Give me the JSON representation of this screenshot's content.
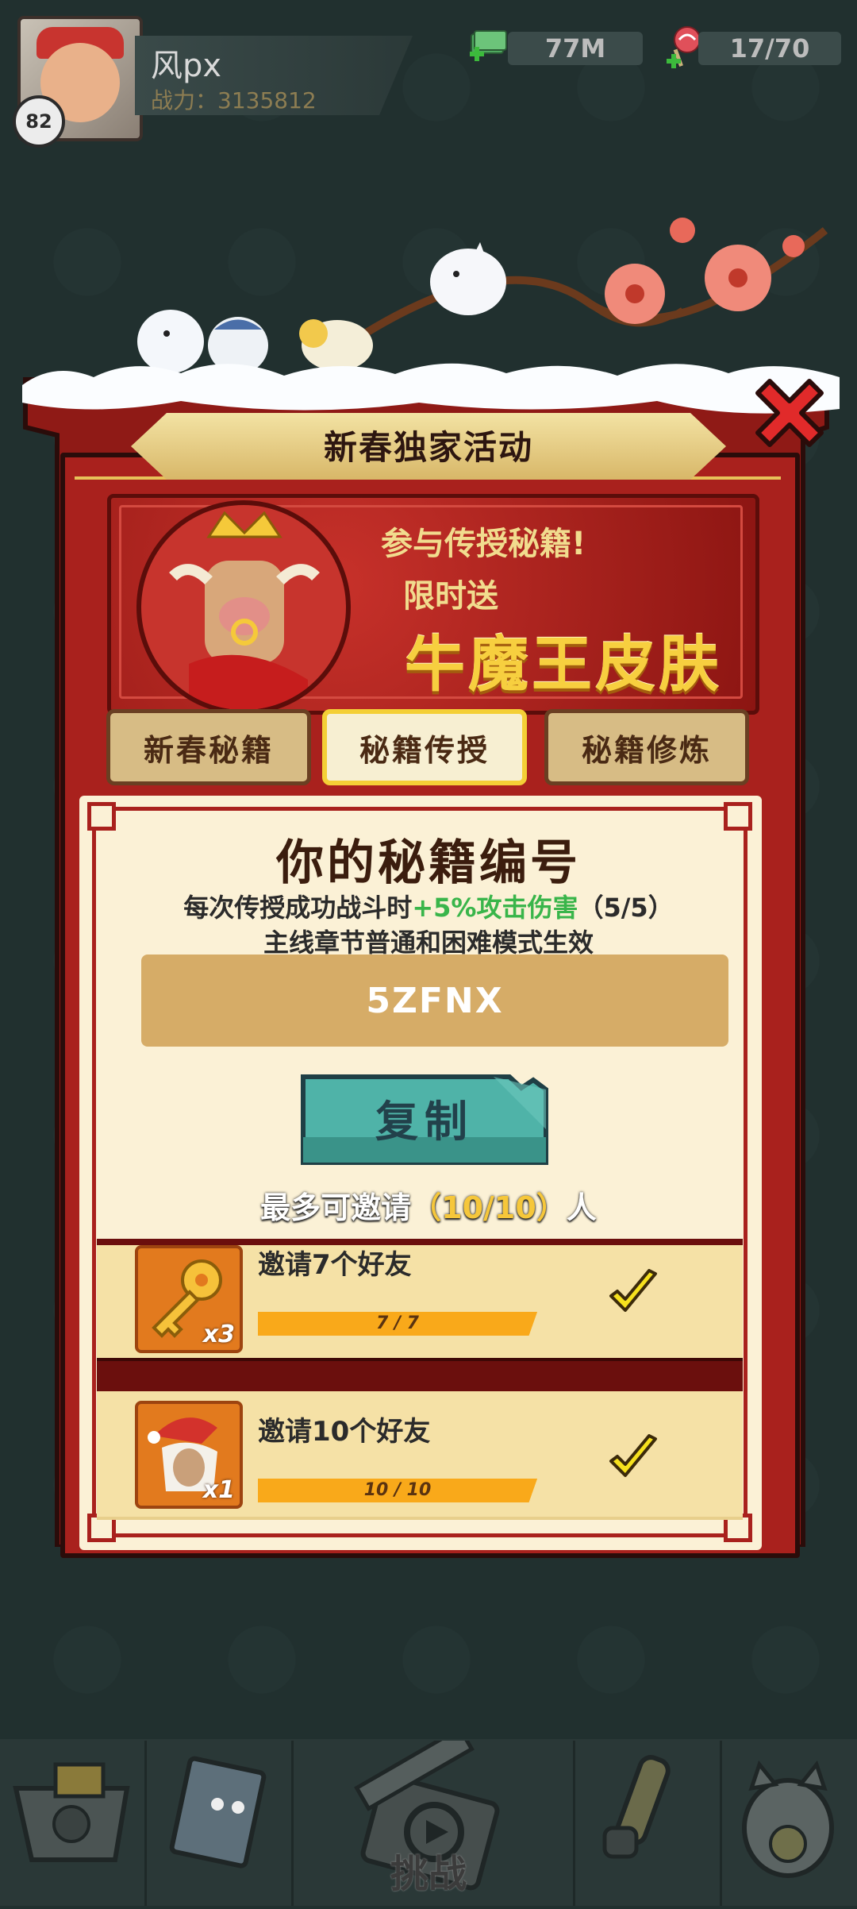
{
  "hud": {
    "level": "82",
    "player_name": "风px",
    "power": "战力：3135812",
    "money": "77M",
    "energy": "17/70"
  },
  "popup": {
    "title": "新春独家活动",
    "banner": {
      "line1": "参与传授秘籍!",
      "line2": "限时送",
      "line3": "牛魔王皮肤"
    },
    "tabs": [
      {
        "label": "新春秘籍",
        "selected": false
      },
      {
        "label": "秘籍传授",
        "selected": true
      },
      {
        "label": "秘籍修炼",
        "selected": false
      }
    ],
    "code_title": "你的秘籍编号",
    "desc_prefix": "每次传授成功战斗时",
    "desc_bonus": "+5%攻击伤害",
    "desc_count": "（5/5）",
    "desc_line2": "主线章节普通和困难模式生效",
    "code": "5ZFNX",
    "copy_label": "复制",
    "invite_prefix": "最多可邀请",
    "invite_count": "（10/10）",
    "invite_suffix": "人",
    "rewards": [
      {
        "label": "邀请7个好友",
        "qty": "x3",
        "progress_text": "7 / 7",
        "progress": 1.0,
        "claimed": true,
        "icon": "key-icon"
      },
      {
        "label": "邀请10个好友",
        "qty": "x1",
        "progress_text": "10 / 10",
        "progress": 1.0,
        "claimed": true,
        "icon": "santa-cow-skin-icon"
      }
    ]
  },
  "bottom_nav": {
    "center_label": "挑战",
    "items": [
      "shop-cart-icon",
      "notebook-icon",
      "clapperboard-icon",
      "scroll-icon",
      "lucky-cat-icon"
    ]
  },
  "colors": {
    "background": "#21302f",
    "frame_red": "#a9211d",
    "gold": "#f7cf3f",
    "bonus_green": "#39b54a",
    "copy_button": "#4fb3a8",
    "progress": "#f9b11e"
  }
}
